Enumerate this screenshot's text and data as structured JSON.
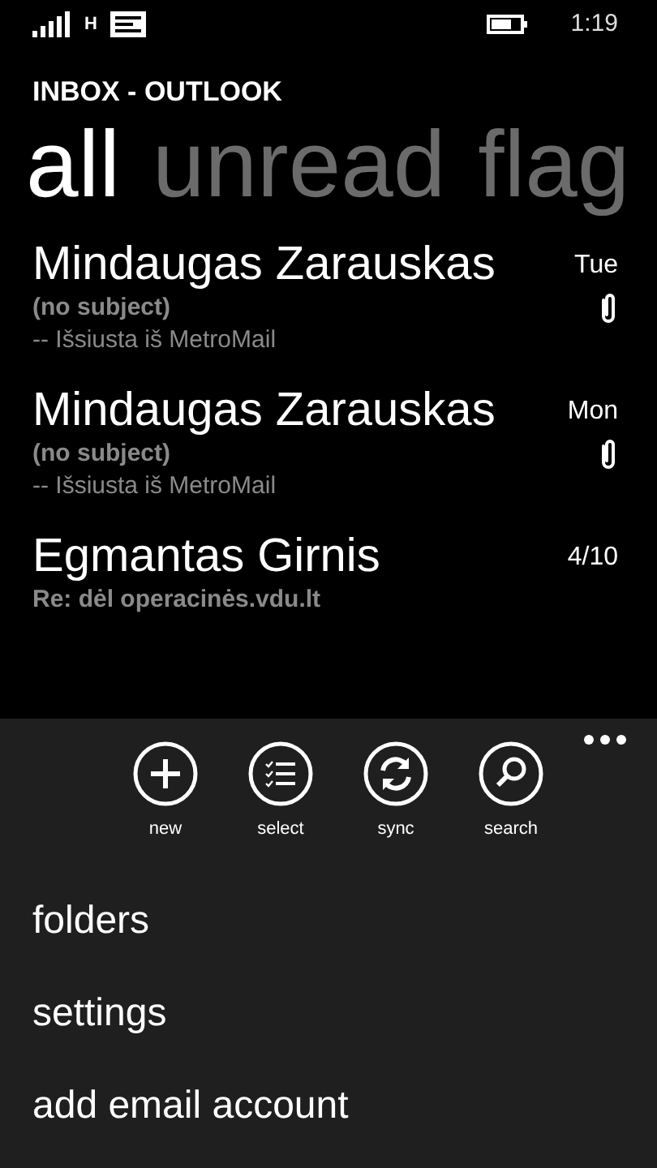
{
  "status_bar": {
    "network": "H",
    "time": "1:19"
  },
  "header": {
    "title": "INBOX - OUTLOOK"
  },
  "pivots": [
    {
      "label": "all",
      "selected": true
    },
    {
      "label": "unread",
      "selected": false
    },
    {
      "label": "flag",
      "selected": false
    }
  ],
  "messages": [
    {
      "sender": "Mindaugas Zarauskas",
      "date": "Tue",
      "subject": "(no subject)",
      "preview": "-- Išsiusta iš MetroMail",
      "attachment": true
    },
    {
      "sender": "Mindaugas Zarauskas",
      "date": "Mon",
      "subject": "(no subject)",
      "preview": "-- Išsiusta iš MetroMail",
      "attachment": true
    },
    {
      "sender": "Egmantas Girnis",
      "date": "4/10",
      "subject": "Re: dėl operacinės.vdu.lt",
      "attachment": false
    }
  ],
  "app_bar": {
    "buttons": [
      {
        "kind": "new",
        "label": "new"
      },
      {
        "kind": "select",
        "label": "select"
      },
      {
        "kind": "sync",
        "label": "sync"
      },
      {
        "kind": "search",
        "label": "search"
      }
    ],
    "menu_items": [
      "folders",
      "settings",
      "add email account"
    ]
  }
}
